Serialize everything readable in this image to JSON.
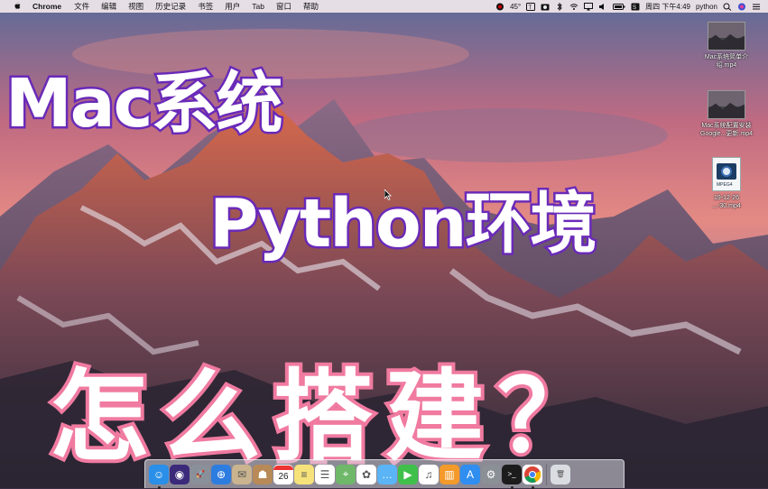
{
  "menubar": {
    "apple": "",
    "app_name": "Chrome",
    "menus": [
      "文件",
      "编辑",
      "视图",
      "历史记录",
      "书签",
      "用户",
      "Tab",
      "窗口",
      "帮助"
    ],
    "status": {
      "temperature": "45°",
      "datetime": "周四 下午4:49",
      "user": "python"
    }
  },
  "desktop_files": [
    {
      "name_line1": "Mac系统简单介",
      "name_line2": "绍.mp4"
    },
    {
      "name_line1": "Mac系统配置安装",
      "name_line2": "Google...更新.mp4"
    },
    {
      "name_line1": "19-12-26",
      "name_line2": "...-30.mp4",
      "icon_tag": "MPEG4"
    }
  ],
  "overlay": {
    "line1": "Mac系统",
    "line2": "Python环境",
    "line3": "怎么搭建？"
  },
  "dock": {
    "calendar_day": "26",
    "items": [
      {
        "name": "finder",
        "color": "#2a8fe8",
        "glyph": "☺"
      },
      {
        "name": "siri",
        "color": "#3b2a7a",
        "glyph": "◉"
      },
      {
        "name": "launchpad",
        "color": "#8a9099",
        "glyph": "🚀"
      },
      {
        "name": "safari",
        "color": "#2d7de0",
        "glyph": "⊕"
      },
      {
        "name": "mail",
        "color": "#c9b48f",
        "glyph": "✉"
      },
      {
        "name": "contacts",
        "color": "#b88a58",
        "glyph": "☗"
      },
      {
        "name": "calendar",
        "color": "#ffffff",
        "glyph": ""
      },
      {
        "name": "notes",
        "color": "#f6e27a",
        "glyph": "≡"
      },
      {
        "name": "reminders",
        "color": "#ffffff",
        "glyph": "☰"
      },
      {
        "name": "maps",
        "color": "#6fb86a",
        "glyph": "⌖"
      },
      {
        "name": "photos",
        "color": "#ffffff",
        "glyph": "✿"
      },
      {
        "name": "messages",
        "color": "#5ab4f5",
        "glyph": "…"
      },
      {
        "name": "facetime",
        "color": "#3fc04b",
        "glyph": "▶"
      },
      {
        "name": "itunes",
        "color": "#ffffff",
        "glyph": "♫"
      },
      {
        "name": "ibooks",
        "color": "#f39a2b",
        "glyph": "▥"
      },
      {
        "name": "app-store",
        "color": "#2f8ef0",
        "glyph": "A"
      },
      {
        "name": "system-preferences",
        "color": "#8b8f96",
        "glyph": "⚙"
      },
      {
        "name": "terminal",
        "color": "#1c1c1c",
        "glyph": ">_"
      },
      {
        "name": "chrome",
        "color": "#ffffff",
        "glyph": ""
      },
      {
        "name": "trash",
        "color": "#d9dde2",
        "glyph": "🗑"
      }
    ]
  }
}
